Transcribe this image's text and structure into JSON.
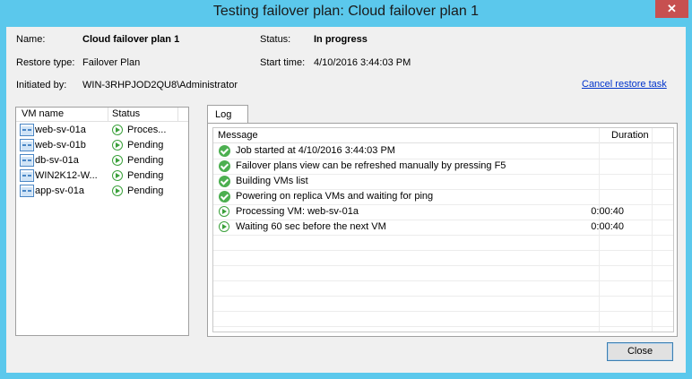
{
  "window": {
    "title": "Testing failover plan: Cloud failover plan 1",
    "close_label": "✕"
  },
  "info": {
    "name_label": "Name:",
    "name_value": "Cloud failover plan 1",
    "restore_type_label": "Restore type:",
    "restore_type_value": "Failover Plan",
    "initiated_by_label": "Initiated by:",
    "initiated_by_value": "WIN-3RHPJOD2QU8\\Administrator",
    "status_label": "Status:",
    "status_value": "In progress",
    "start_time_label": "Start time:",
    "start_time_value": "4/10/2016 3:44:03 PM",
    "cancel_link": "Cancel restore task"
  },
  "vm_list": {
    "headers": [
      "VM name",
      "Status"
    ],
    "rows": [
      {
        "name": "web-sv-01a",
        "status": "Proces...",
        "status_icon": "play-icon"
      },
      {
        "name": "web-sv-01b",
        "status": "Pending",
        "status_icon": "play-icon"
      },
      {
        "name": "db-sv-01a",
        "status": "Pending",
        "status_icon": "play-icon"
      },
      {
        "name": "WIN2K12-W...",
        "status": "Pending",
        "status_icon": "play-icon"
      },
      {
        "name": "app-sv-01a",
        "status": "Pending",
        "status_icon": "play-icon"
      }
    ]
  },
  "log": {
    "tab_label": "Log",
    "headers": [
      "Message",
      "Duration"
    ],
    "rows": [
      {
        "message": "Job started at 4/10/2016 3:44:03 PM",
        "duration": "",
        "icon": "check-icon"
      },
      {
        "message": "Failover plans view can be refreshed manually by pressing F5",
        "duration": "",
        "icon": "check-icon"
      },
      {
        "message": "Building VMs list",
        "duration": "",
        "icon": "check-icon"
      },
      {
        "message": "Powering on replica VMs and waiting for ping",
        "duration": "",
        "icon": "check-icon"
      },
      {
        "message": "Processing VM: web-sv-01a",
        "duration": "0:00:40",
        "icon": "play-icon"
      },
      {
        "message": "Waiting 60 sec before the next VM",
        "duration": "0:00:40",
        "icon": "play-icon"
      }
    ]
  },
  "buttons": {
    "close": "Close"
  }
}
